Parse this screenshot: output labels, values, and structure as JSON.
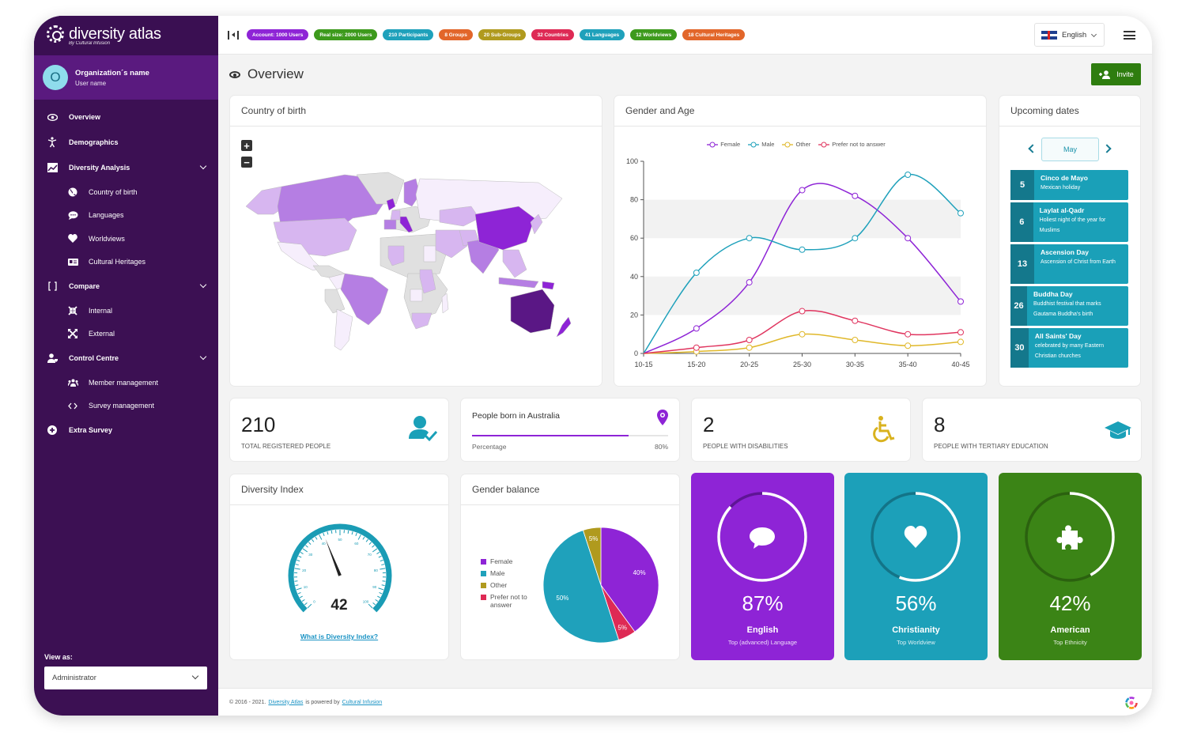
{
  "app": {
    "brand": "diversity atlas",
    "brand_sub": "By Cultural Infusion"
  },
  "org": {
    "initial": "O",
    "name": "Organization´s name",
    "user": "User name"
  },
  "sidebar": {
    "items": [
      {
        "label": "Overview",
        "icon": "eye-icon"
      },
      {
        "label": "Demographics",
        "icon": "person-icon"
      },
      {
        "label": "Diversity Analysis",
        "icon": "chart-icon"
      },
      {
        "label": "Country of birth",
        "icon": "globe-icon"
      },
      {
        "label": "Languages",
        "icon": "speech-bubble-icon"
      },
      {
        "label": "Worldviews",
        "icon": "heart-icon"
      },
      {
        "label": "Cultural Heritages",
        "icon": "id-card-icon"
      },
      {
        "label": "Compare",
        "icon": "brackets-icon"
      },
      {
        "label": "Internal",
        "icon": "compress-icon"
      },
      {
        "label": "External",
        "icon": "expand-icon"
      },
      {
        "label": "Control Centre",
        "icon": "user-shield-icon"
      },
      {
        "label": "Member management",
        "icon": "users-icon"
      },
      {
        "label": "Survey management",
        "icon": "code-icon"
      },
      {
        "label": "Extra Survey",
        "icon": "plus-circle-icon"
      }
    ],
    "view_as_label": "View as:",
    "view_as_value": "Administrator"
  },
  "topbar": {
    "pills": [
      {
        "label": "Account: 1000 Users",
        "color": "#8e24d6"
      },
      {
        "label": "Real size: 2000 Users",
        "color": "#3d9a1c"
      },
      {
        "label": "210 Participants",
        "color": "#1fa1bb"
      },
      {
        "label": "8 Groups",
        "color": "#e2662a"
      },
      {
        "label": "20 Sub-Groups",
        "color": "#b09a1e"
      },
      {
        "label": "32 Countries",
        "color": "#de2a55"
      },
      {
        "label": "41 Languages",
        "color": "#1fa1bb"
      },
      {
        "label": "12 Worldviews",
        "color": "#3d9a1c"
      },
      {
        "label": "18 Cultural Heritages",
        "color": "#e2662a"
      }
    ],
    "language": "English"
  },
  "page": {
    "title": "Overview",
    "invite_label": "Invite"
  },
  "country_card": {
    "title": "Country of birth"
  },
  "gender_age": {
    "title": "Gender and Age",
    "chart_data": {
      "type": "line",
      "x": [
        "10-15",
        "15-20",
        "20-25",
        "25-30",
        "30-35",
        "35-40",
        "40-45"
      ],
      "ylim": [
        0,
        100
      ],
      "yticks": [
        0,
        20,
        40,
        60,
        80,
        100
      ],
      "series": [
        {
          "name": "Female",
          "color": "#8e24d6",
          "values": [
            0,
            13,
            37,
            85,
            82,
            60,
            27
          ]
        },
        {
          "name": "Male",
          "color": "#1fa1bb",
          "values": [
            0,
            42,
            60,
            54,
            60,
            93,
            73
          ]
        },
        {
          "name": "Other",
          "color": "#e0b82a",
          "values": [
            0,
            1,
            3,
            10,
            7,
            4,
            6
          ]
        },
        {
          "name": "Prefer not to answer",
          "color": "#e0355f",
          "values": [
            0,
            3,
            7,
            22,
            17,
            10,
            11
          ]
        }
      ],
      "legend": "top"
    }
  },
  "dates": {
    "title": "Upcoming dates",
    "month": "May",
    "items": [
      {
        "day": "5",
        "title": "Cinco de Mayo",
        "desc": "Mexican holiday"
      },
      {
        "day": "6",
        "title": "Laylat al-Qadr",
        "desc": "Holiest night of the year for Muslims"
      },
      {
        "day": "13",
        "title": "Ascension Day",
        "desc": "Ascension of Christ from Earth"
      },
      {
        "day": "26",
        "title": "Buddha Day",
        "desc": "Buddhist festival that marks Gautama Buddha's birth"
      },
      {
        "day": "30",
        "title": "All Saints' Day",
        "desc": "celebrated by many Eastern Christian churches"
      }
    ]
  },
  "stats": {
    "registered": {
      "value": "210",
      "label": "TOTAL REGISTERED PEOPLE"
    },
    "australia": {
      "title": "People born in Australia",
      "label": "Percentage",
      "value_text": "80%",
      "fraction": 0.8
    },
    "disabilities": {
      "value": "2",
      "label": "PEOPLE WITH DISABILITIES"
    },
    "tertiary": {
      "value": "8",
      "label": "PEOPLE WITH TERTIARY EDUCATION"
    }
  },
  "diversity_index": {
    "title": "Diversity Index",
    "value": "42",
    "value_num": 42,
    "min": 0,
    "max": 100,
    "ticks": [
      "0",
      "10",
      "20",
      "30",
      "40",
      "50",
      "60",
      "70",
      "80",
      "90",
      "100"
    ],
    "link": "What is Diversity Index?"
  },
  "gender_balance": {
    "title": "Gender balance",
    "chart_data": {
      "type": "pie",
      "slices": [
        {
          "name": "Female",
          "value": 40,
          "label": "40%",
          "color": "#8e24d6"
        },
        {
          "name": "Prefer not to answer",
          "value": 5,
          "label": "5%",
          "color": "#de2a55"
        },
        {
          "name": "Male",
          "value": 50,
          "label": "50%",
          "color": "#1fa1bb"
        },
        {
          "name": "Other",
          "value": 5,
          "label": "5%",
          "color": "#b09a1e"
        }
      ],
      "legend": [
        "Female",
        "Male",
        "Other",
        "Prefer not to answer"
      ],
      "legend_colors": [
        "#8e24d6",
        "#1fa1bb",
        "#b09a1e",
        "#de2a55"
      ]
    }
  },
  "tops": [
    {
      "pct": "87%",
      "fraction": 0.87,
      "name": "English",
      "sub": "Top (advanced) Language",
      "color": "#8e24d6",
      "dark": "#5e1595",
      "icon": "speech-bubble-icon"
    },
    {
      "pct": "56%",
      "fraction": 0.56,
      "name": "Christianity",
      "sub": "Top Worldview",
      "color": "#1ca0b9",
      "dark": "#137488",
      "icon": "heart-icon"
    },
    {
      "pct": "42%",
      "fraction": 0.42,
      "name": "American",
      "sub": "Top Ethnicity",
      "color": "#3b8416",
      "dark": "#2b610f",
      "icon": "puzzle-icon"
    }
  ],
  "footer": {
    "prefix": "© 2016 - 2021.",
    "link1": "Diversity Atlas",
    "middle": "is powered by",
    "link2": "Cultural Infusion"
  }
}
